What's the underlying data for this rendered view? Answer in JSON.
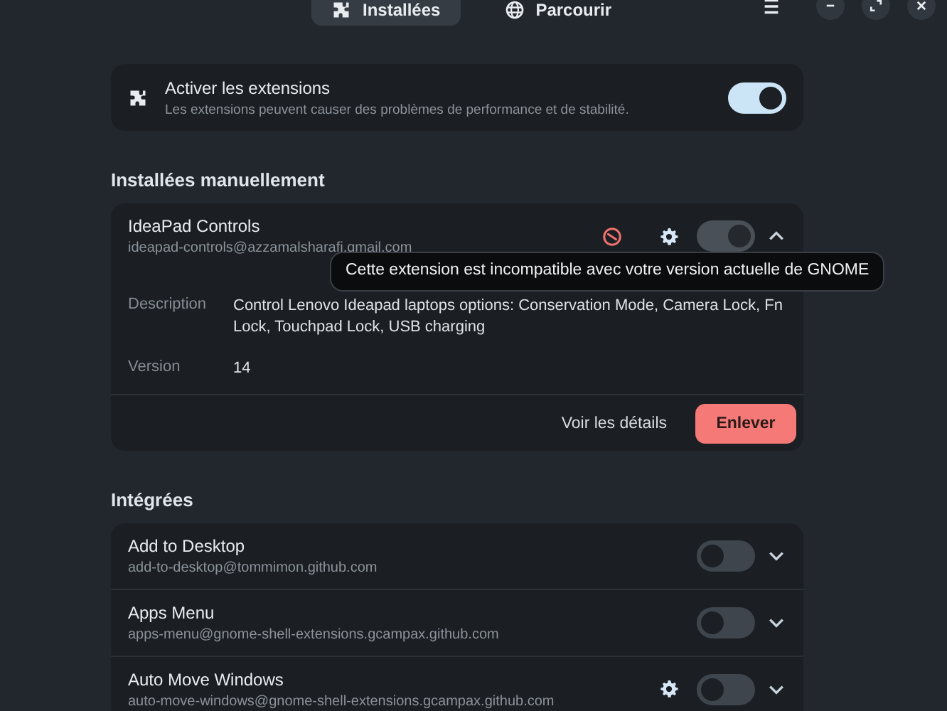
{
  "header": {
    "tabs": [
      {
        "label": "Installées",
        "selected": true
      },
      {
        "label": "Parcourir",
        "selected": false
      }
    ]
  },
  "master": {
    "title": "Activer les extensions",
    "subtitle": "Les extensions peuvent causer des problèmes de performance et de stabilité.",
    "on": true
  },
  "sections": [
    {
      "title": "Installées manuellement",
      "extensions": [
        {
          "name": "IdeaPad Controls",
          "uuid": "ideapad-controls@azzamalsharafi.gmail.com",
          "incompatible": true,
          "has_settings": true,
          "on": true,
          "disabled": true,
          "expanded": true,
          "details": [
            {
              "label": "Description",
              "value": "Control Lenovo Ideapad laptops options: Conservation Mode, Camera Lock, Fn Lock, Touchpad Lock, USB charging"
            },
            {
              "label": "Version",
              "value": "14"
            }
          ],
          "link": "Voir les détails",
          "remove": "Enlever"
        }
      ]
    },
    {
      "title": "Intégrées",
      "extensions": [
        {
          "name": "Add to Desktop",
          "uuid": "add-to-desktop@tommimon.github.com",
          "incompatible": false,
          "has_settings": false,
          "on": false,
          "disabled": false,
          "expanded": false
        },
        {
          "name": "Apps Menu",
          "uuid": "apps-menu@gnome-shell-extensions.gcampax.github.com",
          "incompatible": false,
          "has_settings": false,
          "on": false,
          "disabled": false,
          "expanded": false
        },
        {
          "name": "Auto Move Windows",
          "uuid": "auto-move-windows@gnome-shell-extensions.gcampax.github.com",
          "incompatible": false,
          "has_settings": true,
          "on": false,
          "disabled": false,
          "expanded": false
        }
      ]
    }
  ],
  "tooltip": {
    "text": "Cette extension est incompatible avec votre version actuelle de GNOME"
  }
}
